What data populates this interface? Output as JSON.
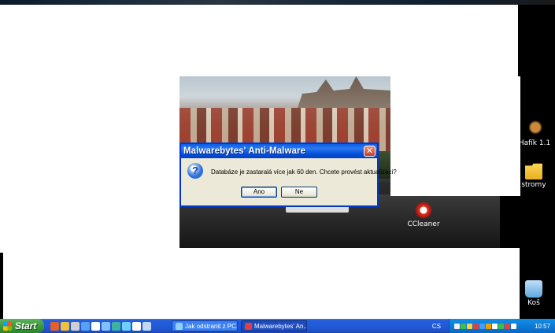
{
  "desktop_icons": [
    {
      "name": "hafik",
      "label": "Hafík 1.1"
    },
    {
      "name": "stromy",
      "label": "stromy"
    },
    {
      "name": "ccleaner",
      "label": "CCleaner"
    },
    {
      "name": "kos",
      "label": "Koš"
    }
  ],
  "dialog": {
    "title": "Malwarebytes' Anti-Malware",
    "close_glyph": "✕",
    "icon_glyph": "?",
    "message": "Databáze je zastaralá více jak 60 den. Chcete provést aktualizaci?",
    "yes_label": "Ano",
    "no_label": "Ne"
  },
  "taskbar": {
    "start_label": "Start",
    "tasks": [
      {
        "label": "Jak odstranit z PC...",
        "icon": "ie-icon"
      },
      {
        "label": "Malwarebytes' An...",
        "icon": "malwarebytes-icon"
      }
    ],
    "language": "CS",
    "clock": "10:57"
  },
  "colors": {
    "titlebar": "#0a5ee8",
    "dialog_bg": "#ece9d8",
    "taskbar": "#245edb",
    "start_green": "#3c9a3c",
    "tray": "#0c7ad8"
  }
}
